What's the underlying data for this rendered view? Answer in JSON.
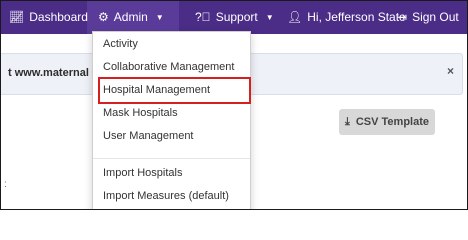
{
  "nav": {
    "dashboard": {
      "icon": "chart-area-icon",
      "label": "Dashboard"
    },
    "admin": {
      "icon": "gear-icon",
      "label": "Admin"
    },
    "support": {
      "icon": "question-circle-icon",
      "label": "Support"
    },
    "user": {
      "icon": "user-icon",
      "label": "Hi, Jefferson State"
    },
    "signout": {
      "icon": "sign-out-icon",
      "label": "Sign Out"
    },
    "caret": "▼",
    "colors": {
      "bar": "#4b2c86",
      "active": "#5b3b99"
    }
  },
  "alert": {
    "text": "t www.maternal",
    "close": "×"
  },
  "csv_button": {
    "icon": "download-icon",
    "label": "CSV Template"
  },
  "admin_menu": {
    "items": [
      {
        "label": "Activity"
      },
      {
        "label": "Collaborative Management"
      },
      {
        "label": "Hospital Management",
        "highlighted": true
      },
      {
        "label": "Mask Hospitals"
      },
      {
        "label": "User Management"
      },
      {
        "label": "Import Hospitals"
      },
      {
        "label": "Import Measures (default)"
      }
    ],
    "highlight_color": "#d42020"
  },
  "stray_text": ":"
}
